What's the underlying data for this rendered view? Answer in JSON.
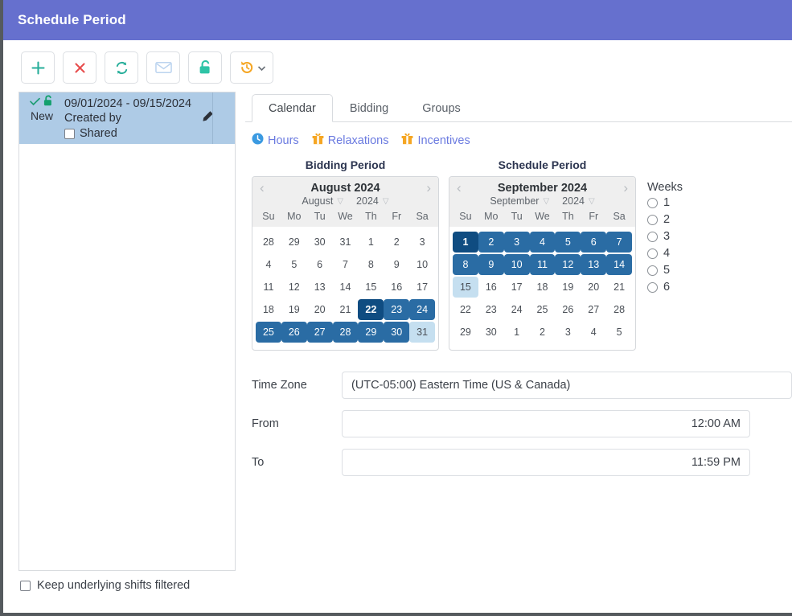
{
  "window": {
    "title": "Schedule Period",
    "header_color": "#6670ce"
  },
  "toolbar": {
    "buttons": [
      {
        "name": "add-button",
        "icon": "plus-icon",
        "color": "#27ae9a"
      },
      {
        "name": "delete-button",
        "icon": "close-icon",
        "color": "#e74c4c"
      },
      {
        "name": "refresh-button",
        "icon": "refresh-icon",
        "color": "#27ae9a"
      },
      {
        "name": "email-button",
        "icon": "envelope-icon",
        "color": "#bcd4ef"
      },
      {
        "name": "unlock-button",
        "icon": "unlock-icon",
        "color": "#2ec4a6"
      },
      {
        "name": "history-button",
        "icon": "history-icon",
        "color": "#f5a623"
      }
    ]
  },
  "list": {
    "items": [
      {
        "status_label": "New",
        "date_range": "09/01/2024 - 09/15/2024",
        "created_by": "Created by",
        "shared_label": "Shared",
        "shared_checked": false,
        "check_icon": "check-icon",
        "lock_icon": "unlock-icon",
        "edit_icon": "pencil-icon",
        "selected": true
      }
    ]
  },
  "tabs": [
    {
      "label": "Calendar",
      "active": true
    },
    {
      "label": "Bidding",
      "active": false
    },
    {
      "label": "Groups",
      "active": false
    }
  ],
  "links": [
    {
      "label": "Hours",
      "icon": "clock-icon",
      "icon_color": "#3b9ae1"
    },
    {
      "label": "Relaxations",
      "icon": "gift-icon",
      "icon_color": "#f5a623"
    },
    {
      "label": "Incentives",
      "icon": "gift-icon",
      "icon_color": "#f5a623"
    }
  ],
  "calendars": [
    {
      "heading": "Bidding Period",
      "title": "August 2024",
      "month": "August",
      "year": "2024",
      "prev_icon": "chevron-left-icon",
      "next_icon": "chevron-right-icon",
      "dow": [
        "Su",
        "Mo",
        "Tu",
        "We",
        "Th",
        "Fr",
        "Sa"
      ],
      "weeks": [
        [
          {
            "d": "28",
            "s": "out"
          },
          {
            "d": "29",
            "s": "out"
          },
          {
            "d": "30",
            "s": "out"
          },
          {
            "d": "31",
            "s": "out"
          },
          {
            "d": "1",
            "s": ""
          },
          {
            "d": "2",
            "s": ""
          },
          {
            "d": "3",
            "s": ""
          }
        ],
        [
          {
            "d": "4",
            "s": ""
          },
          {
            "d": "5",
            "s": ""
          },
          {
            "d": "6",
            "s": ""
          },
          {
            "d": "7",
            "s": ""
          },
          {
            "d": "8",
            "s": ""
          },
          {
            "d": "9",
            "s": ""
          },
          {
            "d": "10",
            "s": ""
          }
        ],
        [
          {
            "d": "11",
            "s": ""
          },
          {
            "d": "12",
            "s": ""
          },
          {
            "d": "13",
            "s": ""
          },
          {
            "d": "14",
            "s": ""
          },
          {
            "d": "15",
            "s": ""
          },
          {
            "d": "16",
            "s": ""
          },
          {
            "d": "17",
            "s": ""
          }
        ],
        [
          {
            "d": "18",
            "s": ""
          },
          {
            "d": "19",
            "s": ""
          },
          {
            "d": "20",
            "s": ""
          },
          {
            "d": "21",
            "s": ""
          },
          {
            "d": "22",
            "s": "sel-dark"
          },
          {
            "d": "23",
            "s": "sel"
          },
          {
            "d": "24",
            "s": "sel"
          }
        ],
        [
          {
            "d": "25",
            "s": "sel"
          },
          {
            "d": "26",
            "s": "sel"
          },
          {
            "d": "27",
            "s": "sel"
          },
          {
            "d": "28",
            "s": "sel"
          },
          {
            "d": "29",
            "s": "sel"
          },
          {
            "d": "30",
            "s": "sel"
          },
          {
            "d": "31",
            "s": "sel-light"
          }
        ]
      ]
    },
    {
      "heading": "Schedule Period",
      "title": "September 2024",
      "month": "September",
      "year": "2024",
      "prev_icon": "chevron-left-icon",
      "next_icon": "chevron-right-icon",
      "dow": [
        "Su",
        "Mo",
        "Tu",
        "We",
        "Th",
        "Fr",
        "Sa"
      ],
      "weeks": [
        [
          {
            "d": "1",
            "s": "sel-dark"
          },
          {
            "d": "2",
            "s": "sel"
          },
          {
            "d": "3",
            "s": "sel"
          },
          {
            "d": "4",
            "s": "sel"
          },
          {
            "d": "5",
            "s": "sel"
          },
          {
            "d": "6",
            "s": "sel"
          },
          {
            "d": "7",
            "s": "sel"
          }
        ],
        [
          {
            "d": "8",
            "s": "sel"
          },
          {
            "d": "9",
            "s": "sel"
          },
          {
            "d": "10",
            "s": "sel"
          },
          {
            "d": "11",
            "s": "sel"
          },
          {
            "d": "12",
            "s": "sel"
          },
          {
            "d": "13",
            "s": "sel"
          },
          {
            "d": "14",
            "s": "sel"
          }
        ],
        [
          {
            "d": "15",
            "s": "sel-light"
          },
          {
            "d": "16",
            "s": ""
          },
          {
            "d": "17",
            "s": ""
          },
          {
            "d": "18",
            "s": ""
          },
          {
            "d": "19",
            "s": ""
          },
          {
            "d": "20",
            "s": ""
          },
          {
            "d": "21",
            "s": ""
          }
        ],
        [
          {
            "d": "22",
            "s": ""
          },
          {
            "d": "23",
            "s": ""
          },
          {
            "d": "24",
            "s": ""
          },
          {
            "d": "25",
            "s": ""
          },
          {
            "d": "26",
            "s": ""
          },
          {
            "d": "27",
            "s": ""
          },
          {
            "d": "28",
            "s": ""
          }
        ],
        [
          {
            "d": "29",
            "s": ""
          },
          {
            "d": "30",
            "s": ""
          },
          {
            "d": "1",
            "s": ""
          },
          {
            "d": "2",
            "s": ""
          },
          {
            "d": "3",
            "s": ""
          },
          {
            "d": "4",
            "s": ""
          },
          {
            "d": "5",
            "s": ""
          }
        ]
      ]
    }
  ],
  "weeks_selector": {
    "title": "Weeks",
    "options": [
      "1",
      "2",
      "3",
      "4",
      "5",
      "6"
    ],
    "selected": null
  },
  "form": {
    "timezone": {
      "label": "Time Zone",
      "value": "(UTC-05:00) Eastern Time (US & Canada)"
    },
    "from": {
      "label": "From",
      "value": "12:00 AM"
    },
    "to": {
      "label": "To",
      "value": "11:59 PM"
    }
  },
  "footer": {
    "keep_filtered_label": "Keep underlying shifts filtered",
    "keep_filtered_checked": false
  },
  "colors": {
    "accent_header": "#6670ce",
    "link": "#6a7ae0",
    "selected_day": "#2a6ca4",
    "selected_day_dark": "#0f4c81",
    "selected_day_light": "#c5dff0",
    "list_selected_bg": "#aecbe6"
  }
}
